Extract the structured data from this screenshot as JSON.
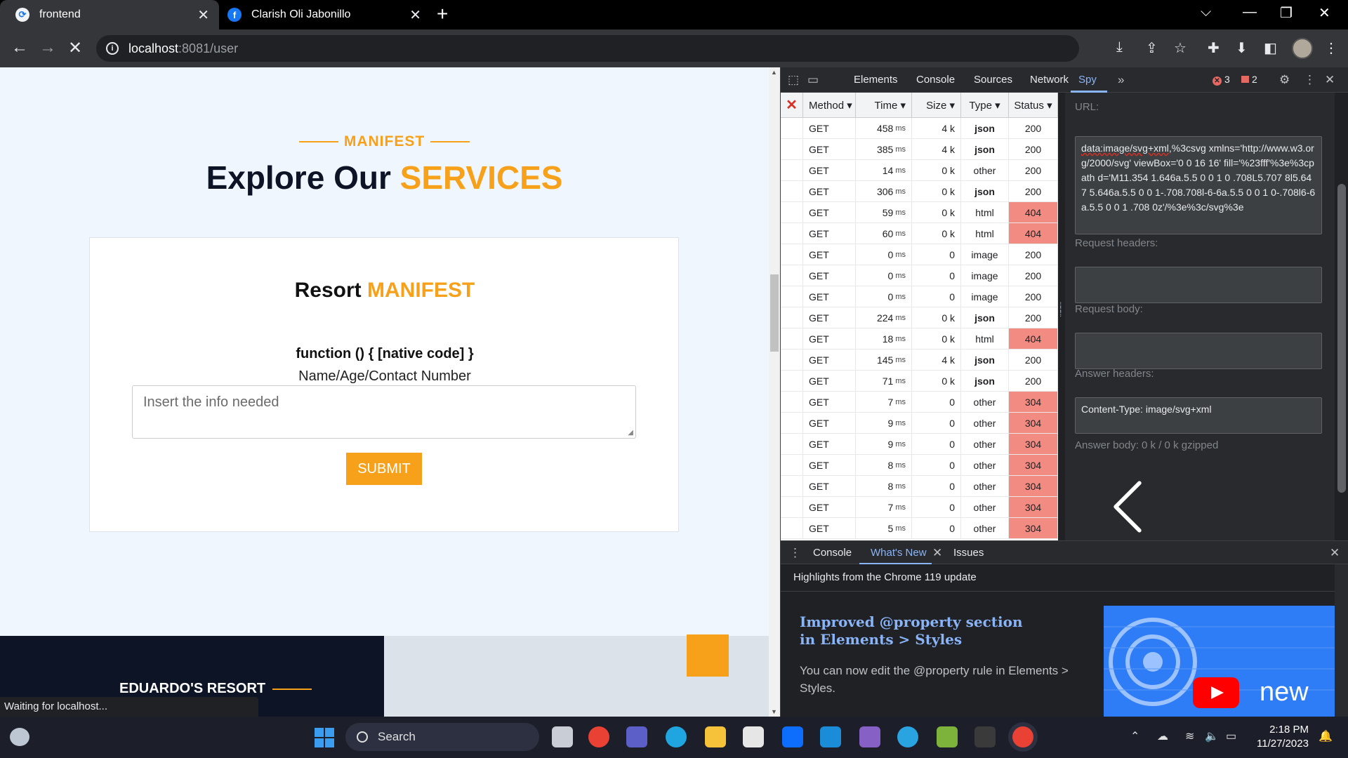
{
  "browser": {
    "tabs": [
      {
        "title": "frontend",
        "active": true
      },
      {
        "title": "Clarish Oli Jabonillo",
        "active": false
      }
    ],
    "url_host": "localhost",
    "url_rest": ":8081/user",
    "status_text": "Waiting for localhost..."
  },
  "page": {
    "kicker": "MANIFEST",
    "title_main": "Explore Our",
    "title_accent": "SERVICES",
    "card_title_main": "Resort",
    "card_title_accent": "MANIFEST",
    "function_label": "function () { [native code] }",
    "field_label": "Name/Age/Contact Number",
    "input_placeholder": "Insert the info needed",
    "submit_label": "SUBMIT",
    "footer_brand": "EDUARDO'S RESORT",
    "accent_color": "#f7a11a",
    "dark_color": "#0d1426"
  },
  "devtools": {
    "tabs": [
      "Elements",
      "Console",
      "Sources",
      "Network",
      "Spy"
    ],
    "active_tab": "Spy",
    "error_count": "3",
    "issue_count": "2",
    "spy": {
      "columns": [
        "Method ▾",
        "Time ▾",
        "Size ▾",
        "Type ▾",
        "Status ▾"
      ],
      "ms_unit": "ms",
      "rows": [
        {
          "method": "GET",
          "time": "458",
          "size": "4 k",
          "type": "json",
          "status": "200"
        },
        {
          "method": "GET",
          "time": "385",
          "size": "4 k",
          "type": "json",
          "status": "200"
        },
        {
          "method": "GET",
          "time": "14",
          "size": "0 k",
          "type": "other",
          "status": "200"
        },
        {
          "method": "GET",
          "time": "306",
          "size": "0 k",
          "type": "json",
          "status": "200"
        },
        {
          "method": "GET",
          "time": "59",
          "size": "0 k",
          "type": "html",
          "status": "404"
        },
        {
          "method": "GET",
          "time": "60",
          "size": "0 k",
          "type": "html",
          "status": "404"
        },
        {
          "method": "GET",
          "time": "0",
          "size": "0",
          "type": "image",
          "status": "200"
        },
        {
          "method": "GET",
          "time": "0",
          "size": "0",
          "type": "image",
          "status": "200"
        },
        {
          "method": "GET",
          "time": "0",
          "size": "0",
          "type": "image",
          "status": "200"
        },
        {
          "method": "GET",
          "time": "224",
          "size": "0 k",
          "type": "json",
          "status": "200"
        },
        {
          "method": "GET",
          "time": "18",
          "size": "0 k",
          "type": "html",
          "status": "404"
        },
        {
          "method": "GET",
          "time": "145",
          "size": "4 k",
          "type": "json",
          "status": "200"
        },
        {
          "method": "GET",
          "time": "71",
          "size": "0 k",
          "type": "json",
          "status": "200"
        },
        {
          "method": "GET",
          "time": "7",
          "size": "0",
          "type": "other",
          "status": "304"
        },
        {
          "method": "GET",
          "time": "9",
          "size": "0",
          "type": "other",
          "status": "304"
        },
        {
          "method": "GET",
          "time": "9",
          "size": "0",
          "type": "other",
          "status": "304"
        },
        {
          "method": "GET",
          "time": "8",
          "size": "0",
          "type": "other",
          "status": "304"
        },
        {
          "method": "GET",
          "time": "8",
          "size": "0",
          "type": "other",
          "status": "304"
        },
        {
          "method": "GET",
          "time": "7",
          "size": "0",
          "type": "other",
          "status": "304"
        },
        {
          "method": "GET",
          "time": "5",
          "size": "0",
          "type": "other",
          "status": "304"
        }
      ],
      "detail": {
        "url_label": "URL:",
        "url_underlined": "data:image/svg+xml",
        "url_rest": ",%3csvg xmlns='http://www.w3.org/2000/svg' viewBox='0 0 16 16' fill='%23fff'%3e%3cpath d='M11.354 1.646a.5.5 0 0 1 0 .708L5.707 8l5.647 5.646a.5.5 0 0 1-.708.708l-6-6a.5.5 0 0 1 0-.708l6-6a.5.5 0 0 1 .708 0z'/%3e%3c/svg%3e",
        "request_headers_label": "Request headers:",
        "request_body_label": "Request body:",
        "answer_headers_label": "Answer headers:",
        "answer_headers_value": "Content-Type: image/svg+xml",
        "answer_body_label": "Answer body: 0 k / 0 k gzipped"
      }
    },
    "drawer": {
      "tabs": [
        "Console",
        "What's New",
        "Issues"
      ],
      "active_tab": "What's New",
      "headline": "Highlights from the Chrome 119 update",
      "feature_title": "Improved @property section in Elements > Styles",
      "feature_text": "You can now edit the @property rule in Elements > Styles.",
      "thumb_text": "new"
    }
  },
  "taskbar": {
    "search_label": "Search",
    "time": "2:18 PM",
    "date": "11/27/2023"
  }
}
